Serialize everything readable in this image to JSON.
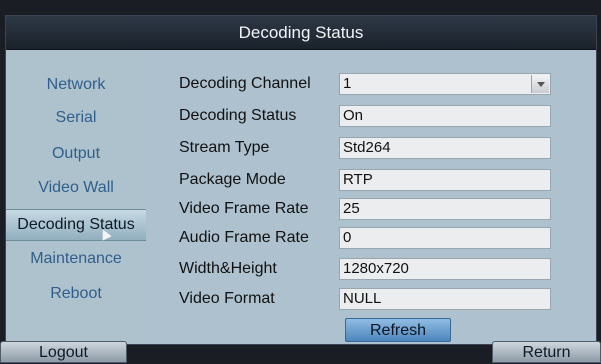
{
  "window": {
    "title": "Decoding Status"
  },
  "sidebar": {
    "items": [
      {
        "label": "Network"
      },
      {
        "label": "Serial"
      },
      {
        "label": "Output"
      },
      {
        "label": "Video Wall"
      },
      {
        "label": "Decoding Status",
        "active": true
      },
      {
        "label": "Maintenance"
      },
      {
        "label": "Reboot"
      }
    ]
  },
  "form": {
    "fields": [
      {
        "label": "Decoding Channel",
        "value": "1",
        "type": "select"
      },
      {
        "label": "Decoding Status",
        "value": "On"
      },
      {
        "label": "Stream Type",
        "value": "Std264"
      },
      {
        "label": "Package Mode",
        "value": "RTP"
      },
      {
        "label": "Video Frame Rate",
        "value": "25"
      },
      {
        "label": "Audio Frame Rate",
        "value": "0"
      },
      {
        "label": "Width&Height",
        "value": "1280x720"
      },
      {
        "label": "Video Format",
        "value": "NULL"
      }
    ],
    "refresh_label": "Refresh"
  },
  "footer": {
    "logout_label": "Logout",
    "return_label": "Return"
  }
}
